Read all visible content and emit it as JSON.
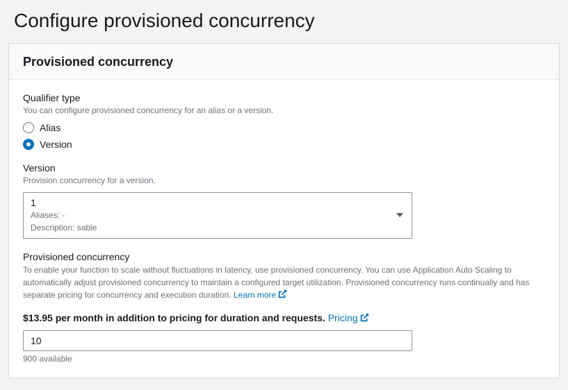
{
  "page": {
    "title": "Configure provisioned concurrency"
  },
  "panel": {
    "heading": "Provisioned concurrency"
  },
  "qualifier": {
    "label": "Qualifier type",
    "hint": "You can configure provisioned concurrency for an alias or a version.",
    "options": {
      "alias": "Alias",
      "version": "Version"
    }
  },
  "version": {
    "label": "Version",
    "hint": "Provision concurrency for a version.",
    "selected_value": "1",
    "aliases_line": "Aliases: -",
    "description_line": "Description: sable"
  },
  "prov": {
    "label": "Provisioned concurrency",
    "description": "To enable your function to scale without fluctuations in latency, use provisioned concurrency. You can use Application Auto Scaling to automatically adjust provisioned concurrency to maintain a configured target utilization. Provisioned concurrency runs continually and has separate pricing for concurrency and execution duration. ",
    "learn_more": "Learn more",
    "price_prefix": "$13.95 per month in addition to pricing for duration and requests. ",
    "pricing_link": "Pricing",
    "input_value": "10",
    "available": "900 available"
  }
}
